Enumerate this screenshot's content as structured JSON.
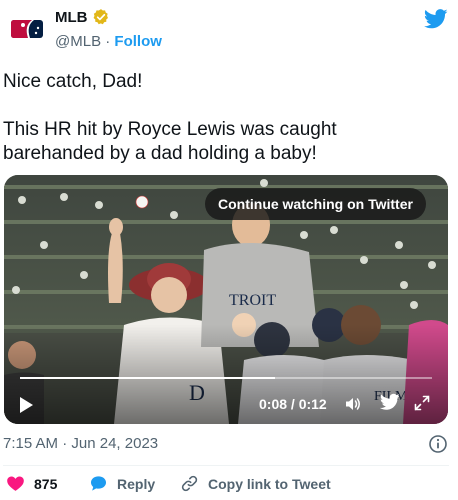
{
  "author": {
    "name": "MLB",
    "handle": "@MLB",
    "separator": "·",
    "follow_label": "Follow",
    "avatar_icon": "mlb-logo-icon",
    "verified_icon": "verified-badge-icon",
    "verified_color": "#e2b719"
  },
  "platform_icon": "twitter-bird-icon",
  "brand_color": "#1d9bf0",
  "tweet": {
    "line1": "Nice catch, Dad!",
    "line2": "This HR hit by Royce Lewis was caught barehanded by a dad holding a baby!"
  },
  "video": {
    "continue_label": "Continue watching on Twitter",
    "time_text": "0:08 / 0:12",
    "progress": 0.62,
    "play_icon": "play-icon",
    "volume_icon": "volume-icon",
    "expand_icon": "expand-icon"
  },
  "meta": {
    "time": "7:15 AM",
    "separator": "·",
    "date": "Jun 24, 2023",
    "info_icon": "info-icon"
  },
  "actions": {
    "like_count": "875",
    "like_color": "#f91880",
    "reply_label": "Reply",
    "copy_label": "Copy link to Tweet"
  }
}
